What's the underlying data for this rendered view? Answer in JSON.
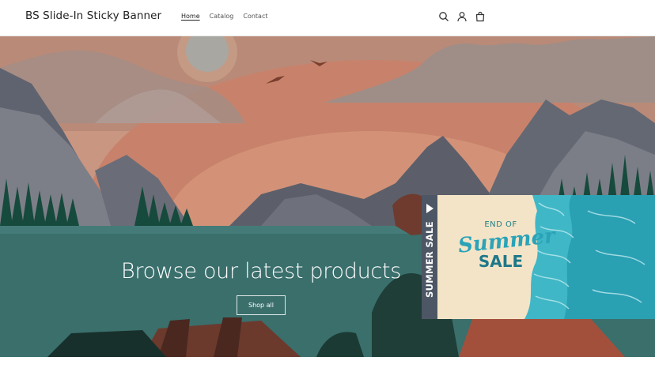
{
  "header": {
    "site_title": "BS Slide-In Sticky Banner",
    "nav": [
      {
        "label": "Home",
        "active": true
      },
      {
        "label": "Catalog",
        "active": false
      },
      {
        "label": "Contact",
        "active": false
      }
    ],
    "icons": [
      "search-icon",
      "account-icon",
      "cart-icon"
    ]
  },
  "hero": {
    "heading": "Browse our latest products",
    "button_label": "Shop all"
  },
  "sticky_banner": {
    "tab_label": "SUMMER SALE",
    "promo_line1": "END OF",
    "promo_line2": "Summer",
    "promo_line3": "SALE",
    "colors": {
      "tab": "#4d5664",
      "sand": "#f3e2c3",
      "sea": "#3fb7c6",
      "text": "#1d7889"
    }
  }
}
